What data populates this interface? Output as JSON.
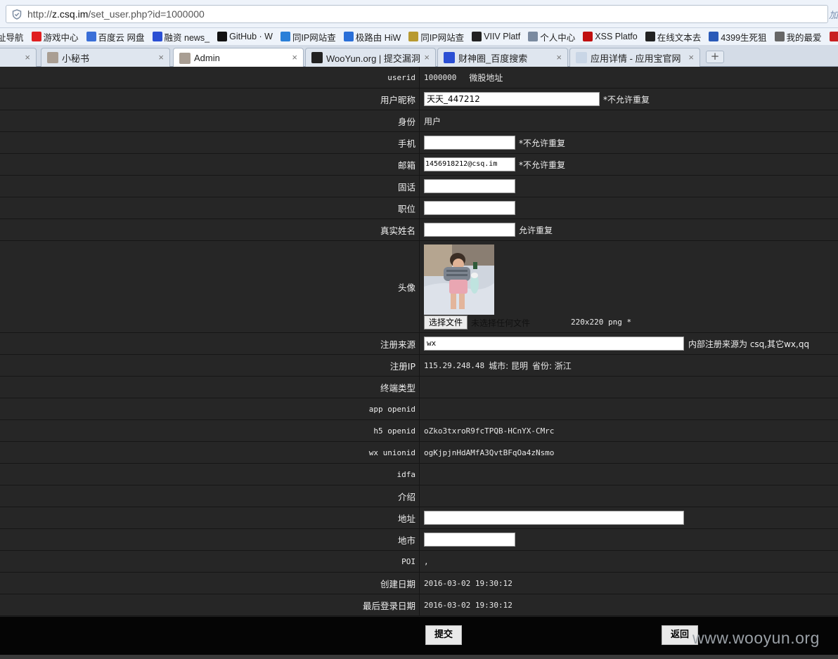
{
  "browser": {
    "url_prefix": "http://",
    "url_host": "z.csq.im",
    "url_path": "/set_user.php?id=1000000",
    "url_right": "加",
    "bookmarks": [
      {
        "label": "址导航",
        "icon": "nav-icon",
        "color": "#e8e8e8"
      },
      {
        "label": "游戏中心",
        "icon": "game-icon",
        "color": "#e02020"
      },
      {
        "label": "百度云 网盘",
        "icon": "cloud-icon",
        "color": "#3a6fd8"
      },
      {
        "label": "融资 news_",
        "icon": "paw-icon",
        "color": "#2b4fd4"
      },
      {
        "label": "GitHub · W",
        "icon": "github-icon",
        "color": "#111111"
      },
      {
        "label": "同IP网站查",
        "icon": "phone-icon",
        "color": "#2a7fd8"
      },
      {
        "label": "极路由 HiW",
        "icon": "router-icon",
        "color": "#2a6fd8"
      },
      {
        "label": "同IP网站查",
        "icon": "bookmark-icon",
        "color": "#b89a30"
      },
      {
        "label": "VIIV Platf",
        "icon": "code-icon",
        "color": "#222222"
      },
      {
        "label": "个人中心",
        "icon": "page-icon",
        "color": "#7a8aa0"
      },
      {
        "label": "XSS Platfo",
        "icon": "xss-icon",
        "color": "#c01010"
      },
      {
        "label": "在线文本去",
        "icon": "text-icon",
        "color": "#222222"
      },
      {
        "label": "4399生死狙",
        "icon": "grid-icon",
        "color": "#2a5ab8"
      },
      {
        "label": "我的最爱",
        "icon": "apps-icon",
        "color": "#666666"
      },
      {
        "label": "",
        "icon": "red-icon",
        "color": "#c82020"
      }
    ],
    "tabs": [
      {
        "label": "",
        "icon": ""
      },
      {
        "label": "小秘书",
        "icon": "avatar-icon"
      },
      {
        "label": "Admin",
        "icon": "avatar-icon"
      },
      {
        "label": "WooYun.org | 提交漏洞",
        "icon": "wooyun-icon"
      },
      {
        "label": "财神圈_百度搜索",
        "icon": "paw-icon"
      },
      {
        "label": "应用详情 - 应用宝官网",
        "icon": "page-icon"
      }
    ],
    "new_tab_label": "+",
    "tab_close": "×"
  },
  "form": {
    "userid": {
      "label": "userid",
      "value": "1000000",
      "link": "微股地址"
    },
    "nickname": {
      "label": "用户昵称",
      "value": "天天_447212",
      "note": "*不允许重复"
    },
    "identity": {
      "label": "身份",
      "value": "用户"
    },
    "mobile": {
      "label": "手机",
      "value": "",
      "note": "*不允许重复"
    },
    "email": {
      "label": "邮箱",
      "value": "1456918212@csq.im",
      "note": "*不允许重复"
    },
    "phone": {
      "label": "固话",
      "value": ""
    },
    "position": {
      "label": "职位",
      "value": ""
    },
    "realname": {
      "label": "真实姓名",
      "value": "",
      "note": "允许重复"
    },
    "avatar": {
      "label": "头像",
      "file_button": "选择文件",
      "file_status": "未选择任何文件",
      "spec": "220x220 png *"
    },
    "reg_source": {
      "label": "注册来源",
      "value": "wx",
      "note": "内部注册来源为 csq,其它wx,qq"
    },
    "reg_ip": {
      "label": "注册IP",
      "ip": "115.29.248.48",
      "city": "城市: 昆明",
      "province": "省份: 浙江"
    },
    "terminal": {
      "label": "终端类型",
      "value": ""
    },
    "app_openid": {
      "label": "app openid",
      "value": ""
    },
    "h5_openid": {
      "label": "h5 openid",
      "value": "oZko3txroR9fcTPQB-HCnYX-CMrc"
    },
    "wx_unionid": {
      "label": "wx unionid",
      "value": "ogKjpjnHdAMfA3QvtBFqOa4zNsmo"
    },
    "idfa": {
      "label": "idfa",
      "value": ""
    },
    "intro": {
      "label": "介绍",
      "value": ""
    },
    "address": {
      "label": "地址",
      "value": ""
    },
    "region": {
      "label": "地市",
      "value": ""
    },
    "poi": {
      "label": "POI",
      "value": ","
    },
    "created": {
      "label": "创建日期",
      "value": "2016-03-02 19:30:12"
    },
    "last_login": {
      "label": "最后登录日期",
      "value": "2016-03-02 19:30:12"
    }
  },
  "actions": {
    "submit": "提交",
    "back": "返回"
  },
  "watermark": "www.wooyun.org"
}
